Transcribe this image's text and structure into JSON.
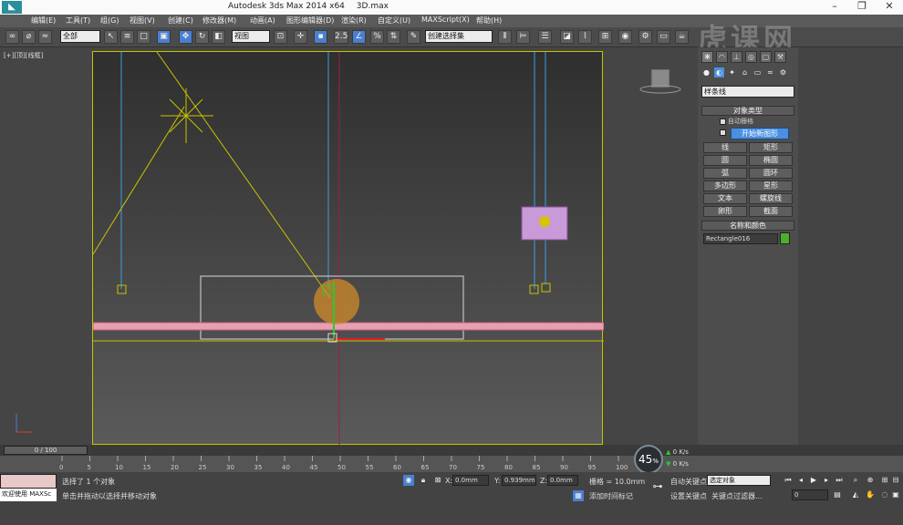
{
  "title": {
    "app": "Autodesk 3ds Max  2014 x64",
    "file": "3D.max"
  },
  "menu": [
    "编辑(E)",
    "工具(T)",
    "组(G)",
    "视图(V)",
    "创建(C)",
    "修改器(M)",
    "动画(A)",
    "图形编辑器(D)",
    "渲染(R)",
    "自定义(U)",
    "MAXScript(X)",
    "帮助(H)"
  ],
  "toolbar": {
    "selection_filter": "全部",
    "ref_coord": "视图",
    "snap_value": "2.5",
    "named_selection": "创建选择集"
  },
  "viewport": {
    "label": "[+][顶][线框]"
  },
  "cmd_panel": {
    "category": "样条线",
    "object_type_title": "对象类型",
    "auto_grid": "自动栅格",
    "start_new_shape": "开始新图形",
    "shapes": [
      "线",
      "矩形",
      "圆",
      "椭圆",
      "弧",
      "圆环",
      "多边形",
      "星形",
      "文本",
      "螺旋线",
      "卵形",
      "截面"
    ],
    "name_color_title": "名称和颜色",
    "object_name": "Rectangle016",
    "object_color": "#4caf2a"
  },
  "watermark": "虎课网",
  "timeline": {
    "frame_display": "0 / 100",
    "ticks": [
      "0",
      "5",
      "10",
      "15",
      "20",
      "25",
      "30",
      "35",
      "40",
      "45",
      "50",
      "55",
      "60",
      "65",
      "70",
      "75",
      "80",
      "85",
      "90",
      "95",
      "100"
    ]
  },
  "status": {
    "maxscript": "欢迎使用 MAXSc",
    "selected": "选择了 1 个对象",
    "prompt": "单击并拖动以选择并移动对象",
    "x_label": "X:",
    "x_value": "0.0mm",
    "y_label": "Y:",
    "y_value": "0.939mm",
    "z_label": "Z:",
    "z_value": "0.0mm",
    "grid": "栅格 = 10.0mm",
    "add_time_tag": "添加时间标记",
    "auto_key": "自动关键点",
    "set_key": "设置关键点",
    "key_filter": "关键点过滤器...",
    "selected_set": "选定对象",
    "frame_field": "0",
    "progress_percent": "45",
    "upload_speed": "0",
    "download_speed": "0",
    "speed_unit": "K/s"
  }
}
